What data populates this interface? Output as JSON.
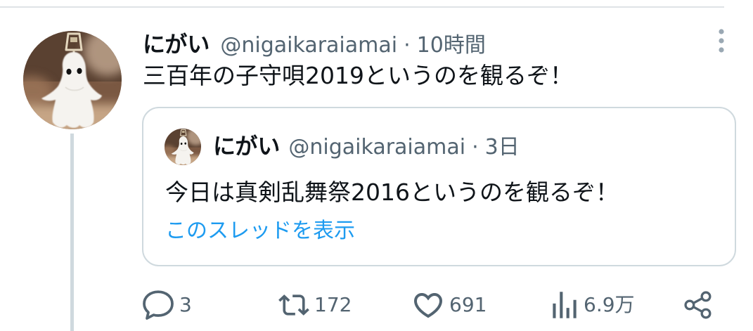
{
  "tweet": {
    "author_name": "にがい",
    "author_handle": "@nigaikaraiamai",
    "separator": "·",
    "time": "10時間",
    "text": "三百年の子守唄2019というのを観るぞ！",
    "more_icon": "more-vertical-icon"
  },
  "quote": {
    "author_name": "にがい",
    "author_handle": "@nigaikaraiamai",
    "separator": "·",
    "time": "3日",
    "text": "今日は真剣乱舞祭2016というのを観るぞ！",
    "show_thread_link": "このスレッドを表示"
  },
  "actions": {
    "reply": {
      "icon": "reply-icon",
      "count": "3"
    },
    "retweet": {
      "icon": "retweet-icon",
      "count": "172"
    },
    "like": {
      "icon": "heart-icon",
      "count": "691"
    },
    "views": {
      "icon": "views-icon",
      "count": "6.9万"
    },
    "share": {
      "icon": "share-icon"
    }
  },
  "colors": {
    "text_primary": "#0f1419",
    "text_secondary": "#536471",
    "link": "#1d9bf0",
    "border": "#cfd9de",
    "background": "#ffffff"
  }
}
